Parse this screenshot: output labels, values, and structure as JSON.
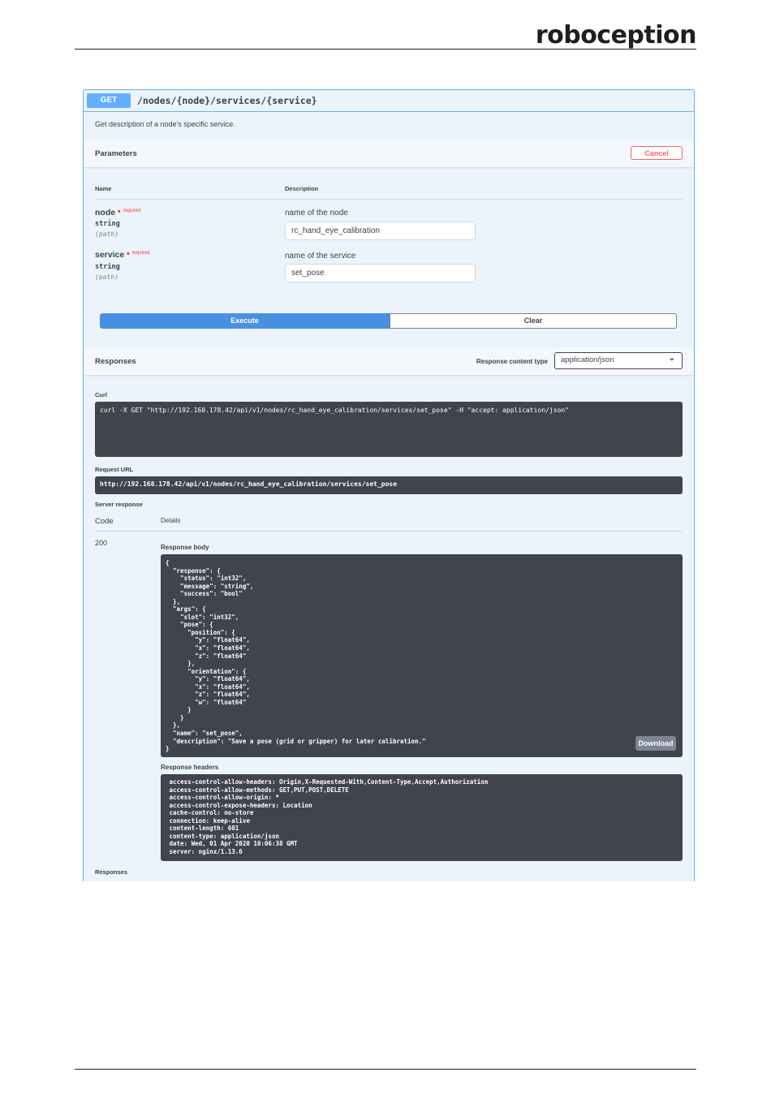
{
  "page": {
    "logo": "roboception"
  },
  "operation": {
    "method": "GET",
    "path": "/nodes/{node}/services/{service}",
    "description": "Get description of a node's specific service."
  },
  "parameters": {
    "title": "Parameters",
    "cancel_label": "Cancel",
    "col_name": "Name",
    "col_description": "Description",
    "required_marker": "*",
    "required_label": "required",
    "items": [
      {
        "name": "node",
        "type": "string",
        "in": "(path)",
        "description": "name of the node",
        "value": "rc_hand_eye_calibration"
      },
      {
        "name": "service",
        "type": "string",
        "in": "(path)",
        "description": "name of the service",
        "value": "set_pose"
      }
    ],
    "execute_label": "Execute",
    "clear_label": "Clear"
  },
  "responses": {
    "title": "Responses",
    "content_type_label": "Response content type",
    "content_type_value": "application/json",
    "curl_label": "Curl",
    "curl_command": "curl -X GET \"http://192.168.178.42/api/v1/nodes/rc_hand_eye_calibration/services/set_pose\" -H \"accept: application/json\"",
    "request_url_label": "Request URL",
    "request_url": "http://192.168.178.42/api/v1/nodes/rc_hand_eye_calibration/services/set_pose",
    "server_response_label": "Server response",
    "col_code": "Code",
    "col_details": "Details",
    "code": "200",
    "response_body_label": "Response body",
    "response_body": "{\n  \"response\": {\n    \"status\": \"int32\",\n    \"message\": \"string\",\n    \"success\": \"bool\"\n  },\n  \"args\": {\n    \"slot\": \"int32\",\n    \"pose\": {\n      \"position\": {\n        \"y\": \"float64\",\n        \"x\": \"float64\",\n        \"z\": \"float64\"\n      },\n      \"orientation\": {\n        \"y\": \"float64\",\n        \"x\": \"float64\",\n        \"z\": \"float64\",\n        \"w\": \"float64\"\n      }\n    }\n  },\n  \"name\": \"set_pose\",\n  \"description\": \"Save a pose (grid or gripper) for later calibration.\"\n}",
    "download_label": "Download",
    "response_headers_label": "Response headers",
    "response_headers": " access-control-allow-headers: Origin,X-Requested-With,Content-Type,Accept,Authorization\n access-control-allow-methods: GET,PUT,POST,DELETE\n access-control-allow-origin: *\n access-control-expose-headers: Location\n cache-control: no-store\n connection: keep-alive\n content-length: 601\n content-type: application/json\n date: Wed, 01 Apr 2020 10:06:38 GMT\n server: nginx/1.13.6",
    "footer_label": "Responses"
  }
}
